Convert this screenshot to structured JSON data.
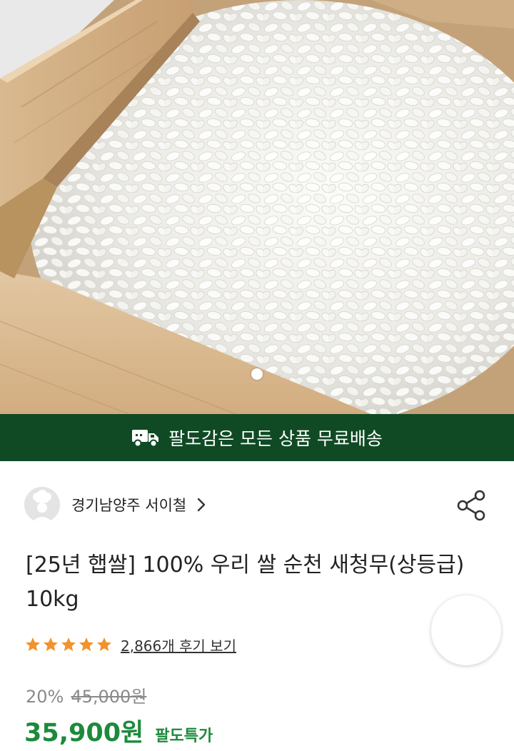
{
  "hero": {
    "image_icon": "rice-in-wooden-box-photo",
    "carousel_total": 1,
    "carousel_current": 1
  },
  "banner": {
    "icon": "truck-icon",
    "text": "팔도감은 모든 상품 무료배송",
    "bg_color": "#0f4a24"
  },
  "seller": {
    "name": "경기남양주 서이철",
    "avatar_icon": "chef-avatar-icon"
  },
  "product": {
    "title": "[25년 햅쌀] 100% 우리 쌀 순천 새청무(상등급) 10kg",
    "rating_stars": 5,
    "review_link": "2,866개 후기 보기",
    "discount": "20%",
    "original_price": "45,000원",
    "final_price": "35,900원",
    "price_tag": "팔도특가",
    "accent_color": "#1c8a3c",
    "star_color": "#f2922b"
  }
}
